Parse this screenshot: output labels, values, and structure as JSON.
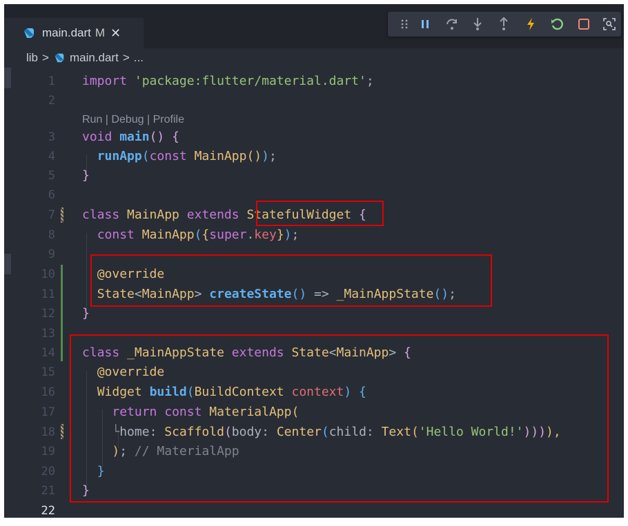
{
  "tab": {
    "file_name": "main.dart",
    "status": "M",
    "close_icon": "close-icon"
  },
  "debug_toolbar": {
    "icons": [
      "drag-handle-icon",
      "pause-icon",
      "step-over-icon",
      "step-into-icon",
      "step-out-icon",
      "hot-reload-icon",
      "hot-restart-icon",
      "stop-icon",
      "inspector-icon"
    ]
  },
  "breadcrumb": {
    "folder": "lib",
    "separator": ">",
    "file": "main.dart",
    "trail": "..."
  },
  "code_lens": {
    "run": "Run",
    "sep": " | ",
    "debug": "Debug",
    "profile": "Profile"
  },
  "lines": {
    "n1": "1",
    "n2": "2",
    "n3": "3",
    "n4": "4",
    "n5": "5",
    "n6": "6",
    "n7": "7",
    "n8": "8",
    "n9": "9",
    "n10": "10",
    "n11": "11",
    "n12": "12",
    "n13": "13",
    "n14": "14",
    "n15": "15",
    "n16": "16",
    "n17": "17",
    "n18": "18",
    "n19": "19",
    "n20": "20",
    "n21": "21",
    "n22": "22"
  },
  "code": {
    "l1": {
      "kw": "import",
      "str": "'package:flutter/material.dart'",
      "end": ";"
    },
    "l3": {
      "kw": "void",
      "fn": "main",
      "p": "()",
      "end": " {"
    },
    "l4": {
      "fn": "runApp",
      "p1": "(",
      "kw": "const",
      "cls": "MainApp",
      "p2": "()",
      "p3": ")",
      "end": ";"
    },
    "l5": {
      "end": "}"
    },
    "l7": {
      "kw1": "class",
      "cls1": "MainApp",
      "kw2": "extends",
      "cls2": "StatefulWidget",
      "end": "{"
    },
    "l8": {
      "kw": "const",
      "cls": "MainApp",
      "p1": "(",
      "b1": "{",
      "kw2": "super",
      "dot": ".",
      "var": "key",
      "b2": "}",
      "p2": ")",
      "end": ";"
    },
    "l10": {
      "ann": "@override"
    },
    "l11": {
      "cls1": "State",
      "lt": "<",
      "cls2": "MainApp",
      "gt": ">",
      "fn": "createState",
      "p": "()",
      "arrow": " => ",
      "cls3": "_MainAppState",
      "p2": "()",
      "end": ";"
    },
    "l12": {
      "end": "}"
    },
    "l14": {
      "kw1": "class",
      "cls1": "_MainAppState",
      "kw2": "extends",
      "cls2": "State",
      "lt": "<",
      "cls3": "MainApp",
      "gt": ">",
      "end": "{"
    },
    "l15": {
      "ann": "@override"
    },
    "l16": {
      "cls1": "Widget",
      "fn": "build",
      "p1": "(",
      "cls2": "BuildContext",
      "var": "context",
      "p2": ")",
      "end": " {"
    },
    "l17": {
      "kw1": "return",
      "kw2": "const",
      "cls": "MaterialApp",
      "p": "("
    },
    "l18": {
      "tree": "└",
      "prop": "home",
      "colon": ": ",
      "cls1": "Scaffold",
      "p1": "(",
      "prop2": "body",
      "colon2": ": ",
      "cls2": "Center",
      "p2": "(",
      "prop3": "child",
      "colon3": ": ",
      "cls3": "Text",
      "p3": "(",
      "str": "'Hello World!'",
      "close": ")))",
      "end": "),"
    },
    "l19": {
      "p": ")",
      "semi": ";",
      "cmt": " // MaterialApp"
    },
    "l20": {
      "end": "}"
    },
    "l21": {
      "end": "}"
    }
  }
}
